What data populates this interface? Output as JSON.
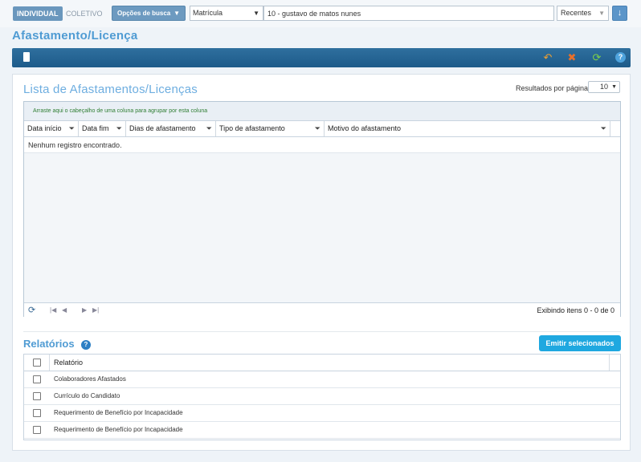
{
  "topbar": {
    "individual": "INDIVIDUAL",
    "coletivo": "COLETIVO",
    "search_options": "Opções de busca",
    "search_field": "Matrícula",
    "search_value": "10 - gustavo de matos nunes",
    "recent": "Recentes",
    "down_icon": "↓"
  },
  "page": {
    "title": "Afastamento/Licença"
  },
  "toolbar": {
    "icons": [
      "document-icon",
      "undo-icon",
      "clear-icon",
      "refresh-icon",
      "help-icon"
    ],
    "help": "?"
  },
  "list": {
    "title": "Lista de Afastamentos/Licenças",
    "results_per_page_label": "Resultados por página",
    "results_per_page": "10",
    "group_hint": "Arraste aqui o cabeçalho de uma coluna para agrupar por esta coluna",
    "columns": [
      "Data início",
      "Data fim",
      "Dias de afastamento",
      "Tipo de afastamento",
      "Motivo do afastamento"
    ],
    "empty_message": "Nenhum registro encontrado.",
    "pager_info": "Exibindo itens 0 - 0 de 0"
  },
  "reports": {
    "title": "Relatórios",
    "help": "?",
    "emit_button": "Emitir selecionados",
    "header": "Relatório",
    "items": [
      "Colaboradores Afastados",
      "Currículo do Candidato",
      "Requerimento de Benefício por Incapacidade",
      "Requerimento de Benefício por Incapacidade"
    ]
  },
  "colors": {
    "accent": "#4f9bd3",
    "toolbar": "#1d5b8a",
    "emit": "#1fa8e0"
  }
}
